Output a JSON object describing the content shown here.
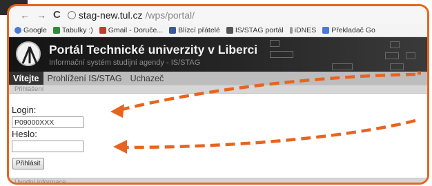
{
  "browser": {
    "url_host": "stag-new.tul.cz",
    "url_path": "/wps/portal/"
  },
  "bookmarks": [
    {
      "label": "Google",
      "icon": "google-icon"
    },
    {
      "label": "Tabulky :)",
      "icon": "sheets-icon"
    },
    {
      "label": "Gmail - Doruče...",
      "icon": "gmail-icon"
    },
    {
      "label": "Blízcí přátelé",
      "icon": "facebook-icon"
    },
    {
      "label": "IS/STAG portál",
      "icon": "stag-icon"
    },
    {
      "label": "iDNES",
      "icon": "idnes-icon"
    },
    {
      "label": "Překladač Go",
      "icon": "translate-icon"
    }
  ],
  "portal": {
    "title": "Portál Technické univerzity v Liberci",
    "subtitle": "Informační systém studijní agendy - IS/STAG"
  },
  "menu": {
    "items": [
      {
        "label": "Vítejte"
      },
      {
        "label": "Prohlížení IS/STAG"
      },
      {
        "label": "Uchazeč"
      }
    ]
  },
  "login_section": {
    "header": "Přihlášení",
    "login_label": "Login:",
    "login_value": "P09000XXX",
    "password_label": "Heslo:",
    "password_value": "",
    "submit_label": "Přihlásit"
  },
  "intro_section": {
    "header": "Úvodní informace"
  },
  "colors": {
    "annotation": "#e8641e",
    "header_bg": "#1e1e1e",
    "menu_bg": "#bdbdbd"
  }
}
